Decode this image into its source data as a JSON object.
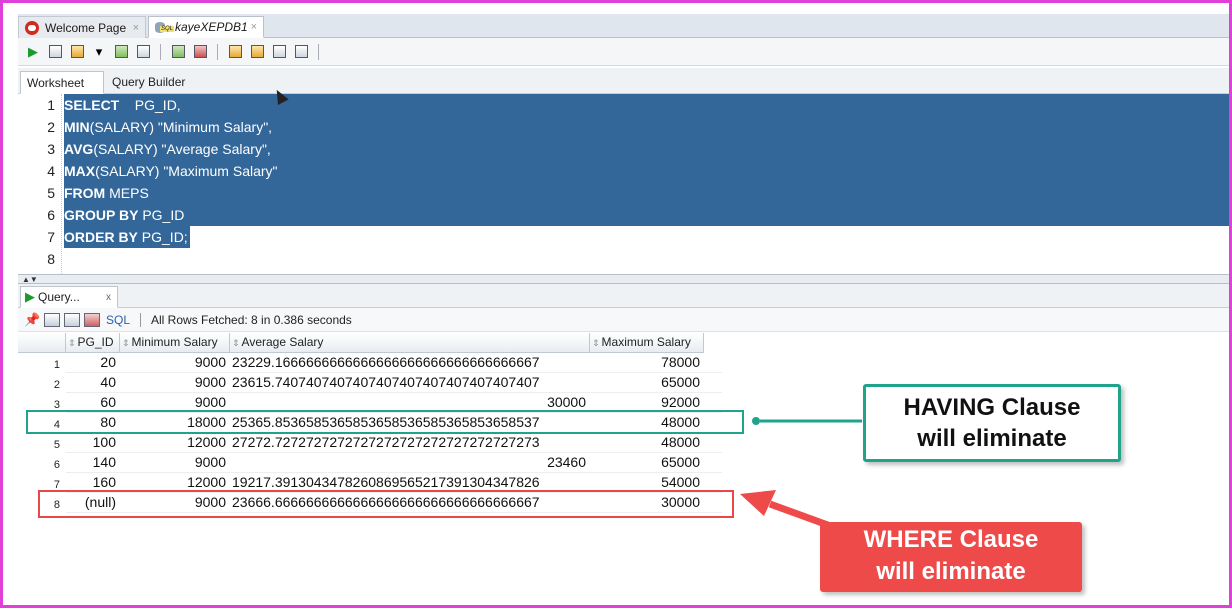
{
  "tabs": [
    {
      "label": "Welcome Page",
      "close": "×"
    },
    {
      "label": "kayeXEPDB1",
      "close": "×"
    }
  ],
  "subtabs": {
    "worksheet": "Worksheet",
    "query_builder": "Query Builder"
  },
  "editor": {
    "line_numbers": [
      "1",
      "2",
      "3",
      "4",
      "5",
      "6",
      "7",
      "8"
    ],
    "lines": [
      {
        "kw": "SELECT",
        "rest": "    PG_ID,"
      },
      {
        "kw": "MIN",
        "rest": "(SALARY) \"Minimum Salary\","
      },
      {
        "kw": "AVG",
        "rest": "(SALARY) \"Average Salary\","
      },
      {
        "kw": "MAX",
        "rest": "(SALARY) \"Maximum Salary\""
      },
      {
        "kw": "FROM",
        "rest": " MEPS"
      },
      {
        "kw": "GROUP BY",
        "rest": " PG_ID"
      },
      {
        "kw": "ORDER BY",
        "rest": " PG_ID;"
      }
    ]
  },
  "results": {
    "tab_label": "Query...",
    "tab_close": "x",
    "sql_label": "SQL",
    "status": "All Rows Fetched: 8 in 0.386 seconds",
    "columns": [
      "PG_ID",
      "Minimum Salary",
      "Average Salary",
      "Maximum Salary"
    ],
    "rows": [
      {
        "n": "1",
        "pg": "20",
        "min": "9000",
        "avg": "23229.1666666666666666666666666666666667",
        "max": "78000"
      },
      {
        "n": "2",
        "pg": "40",
        "min": "9000",
        "avg": "23615.7407407407407407407407407407407407",
        "max": "65000"
      },
      {
        "n": "3",
        "pg": "60",
        "min": "9000",
        "avg": "30000",
        "max": "92000"
      },
      {
        "n": "4",
        "pg": "80",
        "min": "18000",
        "avg": "25365.8536585365853658536585365853658537",
        "max": "48000"
      },
      {
        "n": "5",
        "pg": "100",
        "min": "12000",
        "avg": "27272.7272727272727272727272727272727273",
        "max": "48000"
      },
      {
        "n": "6",
        "pg": "140",
        "min": "9000",
        "avg": "23460",
        "max": "65000"
      },
      {
        "n": "7",
        "pg": "160",
        "min": "12000",
        "avg": "19217.3913043478260869565217391304347826",
        "max": "54000"
      },
      {
        "n": "8",
        "pg": "(null)",
        "min": "9000",
        "avg": "23666.6666666666666666666666666666666667",
        "max": "30000"
      }
    ]
  },
  "annotations": {
    "having_line1": "HAVING Clause",
    "having_line2": "will eliminate",
    "where_line1": "WHERE Clause",
    "where_line2": "will eliminate",
    "having_color": "#1fa38a",
    "where_color": "#e84848"
  }
}
